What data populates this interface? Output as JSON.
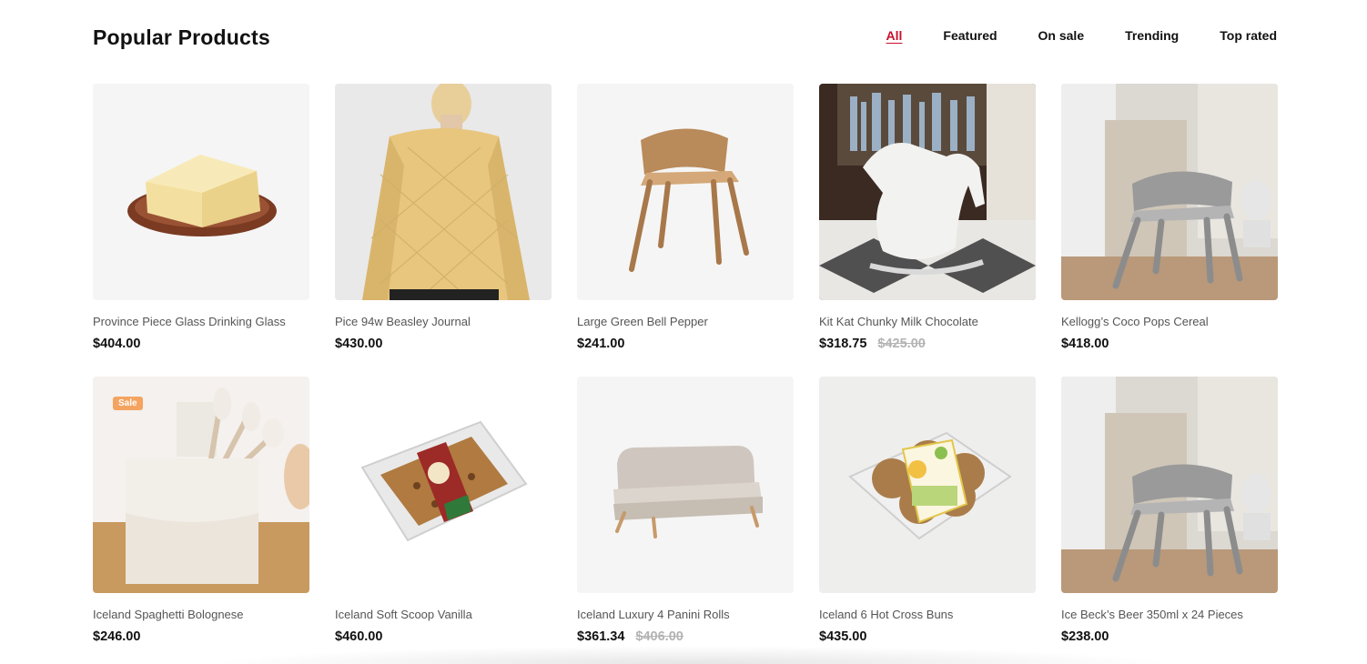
{
  "section": {
    "title": "Popular Products",
    "tabs": [
      {
        "label": "All",
        "active": true
      },
      {
        "label": "Featured",
        "active": false
      },
      {
        "label": "On sale",
        "active": false
      },
      {
        "label": "Trending",
        "active": false
      },
      {
        "label": "Top rated",
        "active": false
      }
    ]
  },
  "products": [
    {
      "name": "Province Piece Glass Drinking Glass",
      "price": "$404.00",
      "old_price": "",
      "badge": "",
      "image": "butter-on-plate"
    },
    {
      "name": "Pice 94w Beasley Journal",
      "price": "$430.00",
      "old_price": "",
      "badge": "",
      "image": "quilted-jacket"
    },
    {
      "name": "Large Green Bell Pepper",
      "price": "$241.00",
      "old_price": "",
      "badge": "",
      "image": "wooden-chair"
    },
    {
      "name": "Kit Kat Chunky Milk Chocolate",
      "price": "$318.75",
      "old_price": "$425.00",
      "badge": "",
      "image": "rocking-horse"
    },
    {
      "name": "Kellogg’s Coco Pops Cereal",
      "price": "$418.00",
      "old_price": "",
      "badge": "",
      "image": "grey-chair-room"
    },
    {
      "name": "Iceland Spaghetti Bolognese",
      "price": "$246.00",
      "old_price": "",
      "badge": "Sale",
      "image": "makeup-brush-holder"
    },
    {
      "name": "Iceland Soft Scoop Vanilla",
      "price": "$460.00",
      "old_price": "",
      "badge": "",
      "image": "cake-pack"
    },
    {
      "name": "Iceland Luxury 4 Panini Rolls",
      "price": "$361.34",
      "old_price": "$406.00",
      "badge": "",
      "image": "sofa"
    },
    {
      "name": "Iceland 6 Hot Cross Buns",
      "price": "$435.00",
      "old_price": "",
      "badge": "",
      "image": "muffin-pack"
    },
    {
      "name": "Ice Beck’s Beer 350ml x 24 Pieces",
      "price": "$238.00",
      "old_price": "",
      "badge": "",
      "image": "grey-chair-room"
    }
  ],
  "colors": {
    "accent": "#c8102e",
    "badge": "#f4a460",
    "old_price": "#b3b3b3"
  }
}
